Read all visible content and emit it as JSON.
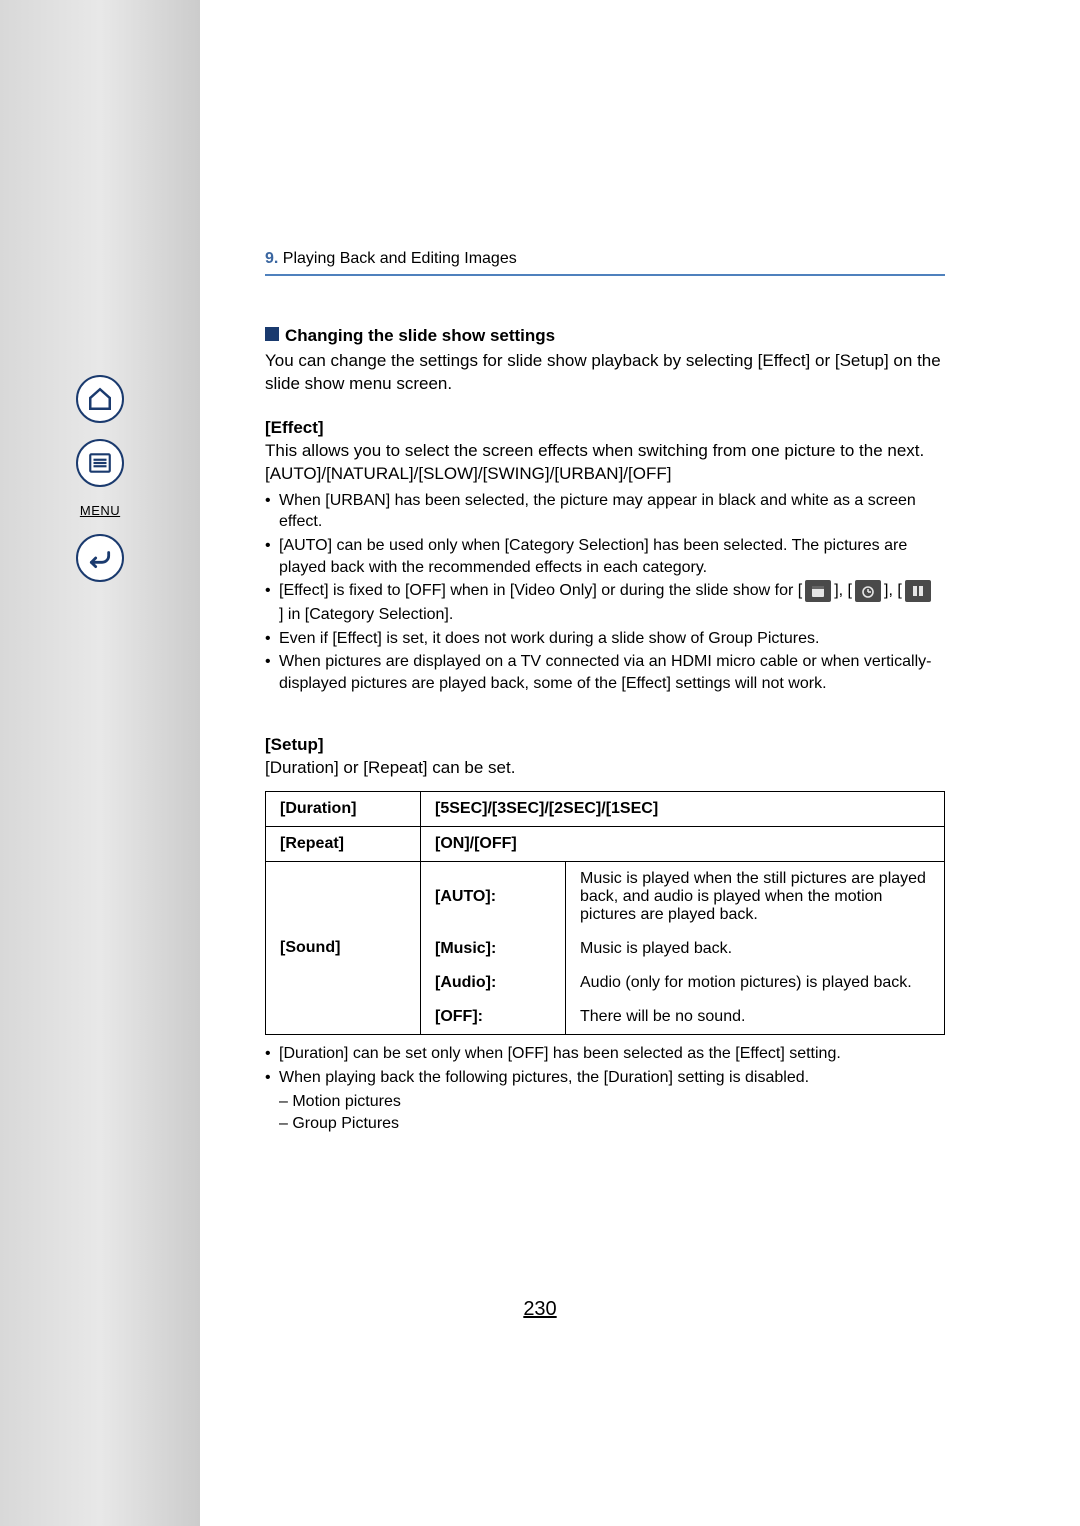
{
  "sidebar": {
    "menu_label": "MENU",
    "icons": {
      "home": "home-icon",
      "list": "list-icon",
      "menu": "menu-label",
      "back": "back-icon"
    }
  },
  "breadcrumb": {
    "number": "9.",
    "title": "Playing Back and Editing Images"
  },
  "section": {
    "title": "Changing the slide show settings",
    "intro": "You can change the settings for slide show playback by selecting [Effect] or [Setup] on the slide show menu screen."
  },
  "effect": {
    "title": "[Effect]",
    "desc": "This allows you to select the screen effects when switching from one picture to the next.",
    "options": "[AUTO]/[NATURAL]/[SLOW]/[SWING]/[URBAN]/[OFF]",
    "bullets": [
      "When [URBAN] has been selected, the picture may appear in black and white as a screen effect.",
      "[AUTO] can be used only when [Category Selection] has been selected. The pictures are played back with the recommended effects in each category."
    ],
    "bullet3_parts": {
      "a": "[Effect] is fixed to [OFF] when in [Video Only] or during the slide show for [",
      "b": "], [",
      "c": "], [",
      "d": "] in [Category Selection]."
    },
    "bullets_after": [
      "Even if [Effect] is set, it does not work during a slide show of Group Pictures.",
      "When pictures are displayed on a TV connected via an HDMI micro cable or when vertically-displayed pictures are played back, some of the [Effect] settings will not work."
    ]
  },
  "setup": {
    "title": "[Setup]",
    "intro": "[Duration] or [Repeat] can be set.",
    "rows": {
      "duration": {
        "label": "[Duration]",
        "value": "[5SEC]/[3SEC]/[2SEC]/[1SEC]"
      },
      "repeat": {
        "label": "[Repeat]",
        "value": "[ON]/[OFF]"
      },
      "sound": {
        "label": "[Sound]",
        "options": [
          {
            "name": "[AUTO]:",
            "desc": "Music is played when the still pictures are played back, and audio is played when the motion pictures are played back."
          },
          {
            "name": "[Music]:",
            "desc": "Music is played back."
          },
          {
            "name": "[Audio]:",
            "desc": "Audio (only for motion pictures) is played back."
          },
          {
            "name": "[OFF]:",
            "desc": "There will be no sound."
          }
        ]
      }
    },
    "footnotes": [
      "[Duration] can be set only when [OFF] has been selected as the [Effect] setting.",
      "When playing back the following pictures, the [Duration] setting is disabled."
    ],
    "dashes": [
      "– Motion pictures",
      "– Group Pictures"
    ]
  },
  "page_number": "230"
}
